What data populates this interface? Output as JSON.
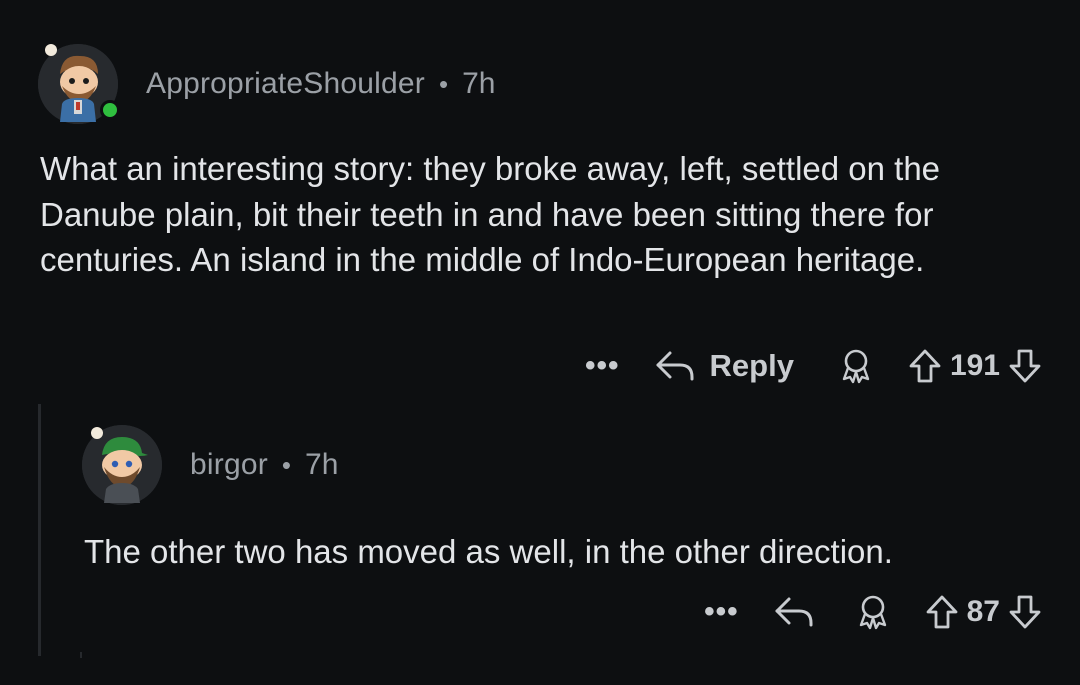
{
  "comments": [
    {
      "username": "AppropriateShoulder",
      "separator": "•",
      "time": "7h",
      "online": true,
      "body": "What an interesting story: they broke away, left, settled on the Danube plain, bit their teeth in and have been sitting there for centuries. An island in the middle of Indo-European heritage.",
      "actions": {
        "more_label": "•••",
        "reply_label": "Reply",
        "vote_count": "191"
      }
    },
    {
      "username": "birgor",
      "separator": "•",
      "time": "7h",
      "body": "The other two has moved as well, in the other direction.",
      "actions": {
        "more_label": "•••",
        "vote_count": "87"
      }
    }
  ],
  "colors": {
    "background": "#0d0f11",
    "text": "#e3e5e8",
    "meta": "#9ba0a6",
    "online": "#2fbf3f"
  },
  "icons": [
    "reply-icon",
    "award-icon",
    "upvote-icon",
    "downvote-icon",
    "more-icon"
  ]
}
